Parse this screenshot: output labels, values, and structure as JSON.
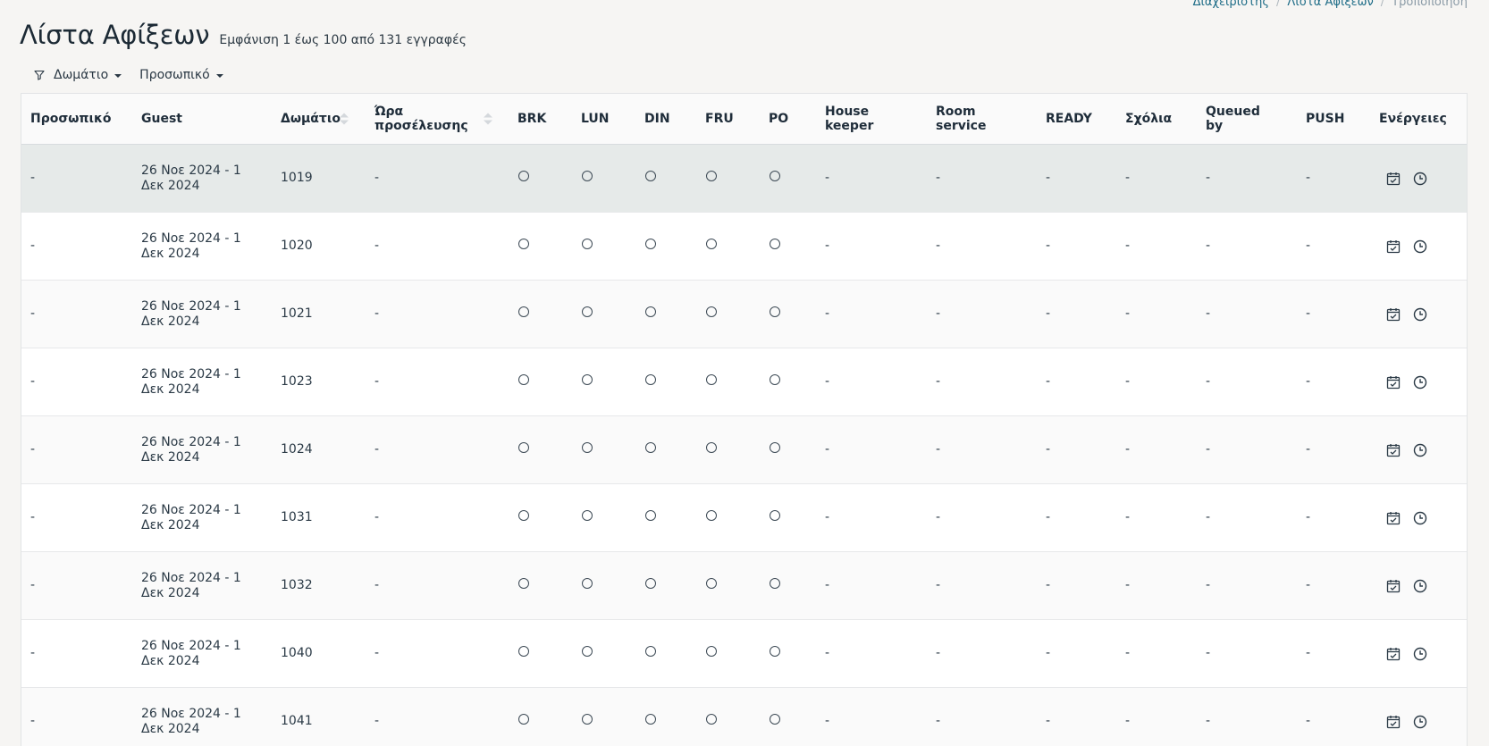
{
  "breadcrumb": {
    "items": [
      "Διαχειριστής",
      "Λίστα Αφίξεων"
    ],
    "current": "Τροποποίηση"
  },
  "page": {
    "title": "Λίστα Αφίξεων",
    "subtitle": "Εμφάνιση 1 έως 100 από 131 εγγραφές"
  },
  "filters": [
    {
      "label": "Δωμάτιο",
      "icon": "filter-icon"
    },
    {
      "label": "Προσωπικό"
    }
  ],
  "table": {
    "columns": [
      "Προσωπικό",
      "Guest",
      "Δωμάτιο",
      "Ώρα προσέλευσης",
      "BRK",
      "LUN",
      "DIN",
      "FRU",
      "PO",
      "House keeper",
      "Room service",
      "READY",
      "Σχόλια",
      "Queued by",
      "PUSH",
      "Ενέργειες"
    ],
    "rows": [
      {
        "staff": "-",
        "guest": "26 Νοε 2024 - 1 Δεκ 2024",
        "room": "1019",
        "arrival": "-",
        "housekeeper": "-",
        "room_service": "-",
        "ready": "-",
        "comments": "-",
        "queued_by": "-",
        "push": "-"
      },
      {
        "staff": "-",
        "guest": "26 Νοε 2024 - 1 Δεκ 2024",
        "room": "1020",
        "arrival": "-",
        "housekeeper": "-",
        "room_service": "-",
        "ready": "-",
        "comments": "-",
        "queued_by": "-",
        "push": "-"
      },
      {
        "staff": "-",
        "guest": "26 Νοε 2024 - 1 Δεκ 2024",
        "room": "1021",
        "arrival": "-",
        "housekeeper": "-",
        "room_service": "-",
        "ready": "-",
        "comments": "-",
        "queued_by": "-",
        "push": "-"
      },
      {
        "staff": "-",
        "guest": "26 Νοε 2024 - 1 Δεκ 2024",
        "room": "1023",
        "arrival": "-",
        "housekeeper": "-",
        "room_service": "-",
        "ready": "-",
        "comments": "-",
        "queued_by": "-",
        "push": "-"
      },
      {
        "staff": "-",
        "guest": "26 Νοε 2024 - 1 Δεκ 2024",
        "room": "1024",
        "arrival": "-",
        "housekeeper": "-",
        "room_service": "-",
        "ready": "-",
        "comments": "-",
        "queued_by": "-",
        "push": "-"
      },
      {
        "staff": "-",
        "guest": "26 Νοε 2024 - 1 Δεκ 2024",
        "room": "1031",
        "arrival": "-",
        "housekeeper": "-",
        "room_service": "-",
        "ready": "-",
        "comments": "-",
        "queued_by": "-",
        "push": "-"
      },
      {
        "staff": "-",
        "guest": "26 Νοε 2024 - 1 Δεκ 2024",
        "room": "1032",
        "arrival": "-",
        "housekeeper": "-",
        "room_service": "-",
        "ready": "-",
        "comments": "-",
        "queued_by": "-",
        "push": "-"
      },
      {
        "staff": "-",
        "guest": "26 Νοε 2024 - 1 Δεκ 2024",
        "room": "1040",
        "arrival": "-",
        "housekeeper": "-",
        "room_service": "-",
        "ready": "-",
        "comments": "-",
        "queued_by": "-",
        "push": "-"
      },
      {
        "staff": "-",
        "guest": "26 Νοε 2024 - 1 Δεκ 2024",
        "room": "1041",
        "arrival": "-",
        "housekeeper": "-",
        "room_service": "-",
        "ready": "-",
        "comments": "-",
        "queued_by": "-",
        "push": "-"
      }
    ],
    "action_icons": [
      "calendar-check-icon",
      "clock-icon"
    ]
  },
  "colors": {
    "background": "#f6f5f3",
    "link": "#1c6b86",
    "row_highlight": "#e6eae9",
    "text": "#21313c"
  }
}
